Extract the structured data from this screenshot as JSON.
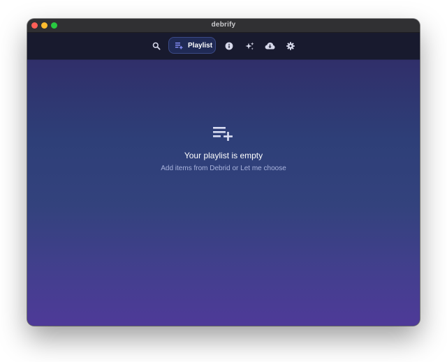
{
  "window": {
    "title": "debrify"
  },
  "nav": {
    "items": [
      {
        "icon": "search-icon",
        "label": ""
      },
      {
        "icon": "playlist-icon",
        "label": "Playlist",
        "active": true
      },
      {
        "icon": "info-icon",
        "label": ""
      },
      {
        "icon": "sparkles-icon",
        "label": ""
      },
      {
        "icon": "cloud-download-icon",
        "label": ""
      },
      {
        "icon": "gear-icon",
        "label": ""
      }
    ],
    "active_label": "Playlist"
  },
  "empty_state": {
    "icon": "playlist-add-icon",
    "title": "Your playlist is empty",
    "subtitle": "Add items from Debrid or Let me choose"
  },
  "colors": {
    "accent": "#6b72e8",
    "toolbar_bg": "#181a2e",
    "content_top": "#302f6a",
    "content_bottom": "#4e3a98"
  }
}
